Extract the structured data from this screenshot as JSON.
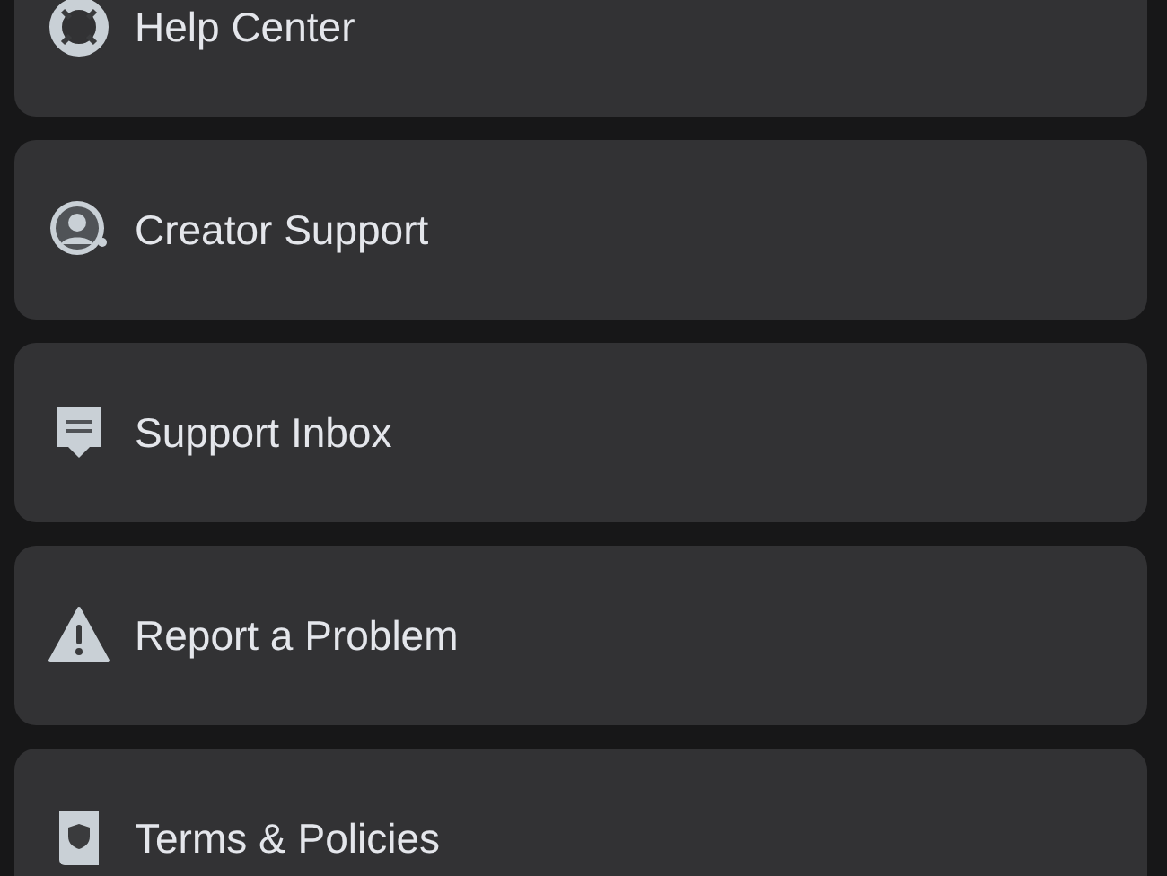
{
  "menu_items": [
    {
      "label": "Help Center",
      "kind": "lifebuoy"
    },
    {
      "label": "Creator Support",
      "kind": "support-agent"
    },
    {
      "label": "Support Inbox",
      "kind": "inbox"
    },
    {
      "label": "Report a Problem",
      "kind": "warning"
    },
    {
      "label": "Terms & Policies",
      "kind": "book"
    }
  ]
}
